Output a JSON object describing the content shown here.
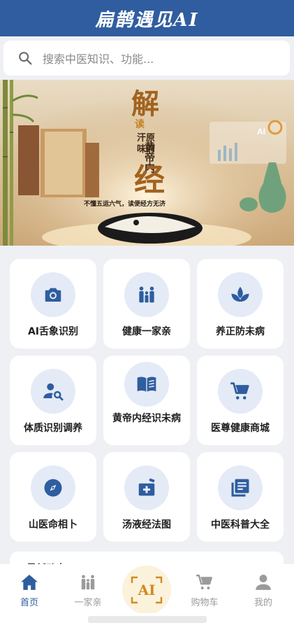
{
  "header": {
    "title": "扁鹊遇见AI"
  },
  "search": {
    "placeholder": "搜索中医知识、功能..."
  },
  "banner": {
    "big_char_top": "解",
    "small_read": "读",
    "small_line2": "汗原",
    "small_line3": "味的",
    "book_title": "黄帝内",
    "big_char_bottom": "经",
    "slogan": "不懂五运六气，读便经方无济",
    "badge": "AI"
  },
  "grid": [
    {
      "label": "AI舌象识别",
      "icon": "camera-icon"
    },
    {
      "label": "健康一家亲",
      "icon": "family-icon"
    },
    {
      "label": "养正防未病",
      "icon": "spa-icon"
    },
    {
      "label": "体质识别调养",
      "icon": "person-search-icon"
    },
    {
      "label": "黄帝内经识未病",
      "icon": "book-icon"
    },
    {
      "label": "医尊健康商城",
      "icon": "cart-icon"
    },
    {
      "label": "山医命相卜",
      "icon": "compass-icon"
    },
    {
      "label": "汤液经法图",
      "icon": "medicine-icon"
    },
    {
      "label": "中医科普大全",
      "icon": "library-icon"
    }
  ],
  "section": {
    "title": "最新动态"
  },
  "tabbar": {
    "items": [
      {
        "label": "首页",
        "icon": "home-icon",
        "active": true
      },
      {
        "label": "一家亲",
        "icon": "family-icon",
        "active": false
      },
      {
        "label": "AI",
        "icon": "ai-icon",
        "active": false
      },
      {
        "label": "购物车",
        "icon": "cart-icon",
        "active": false
      },
      {
        "label": "我的",
        "icon": "person-icon",
        "active": false
      }
    ]
  },
  "colors": {
    "primary": "#2f5d9f",
    "icon_bg": "#e4ebf6",
    "inactive": "#9b9b9b",
    "ai_accent": "#d08a22"
  }
}
